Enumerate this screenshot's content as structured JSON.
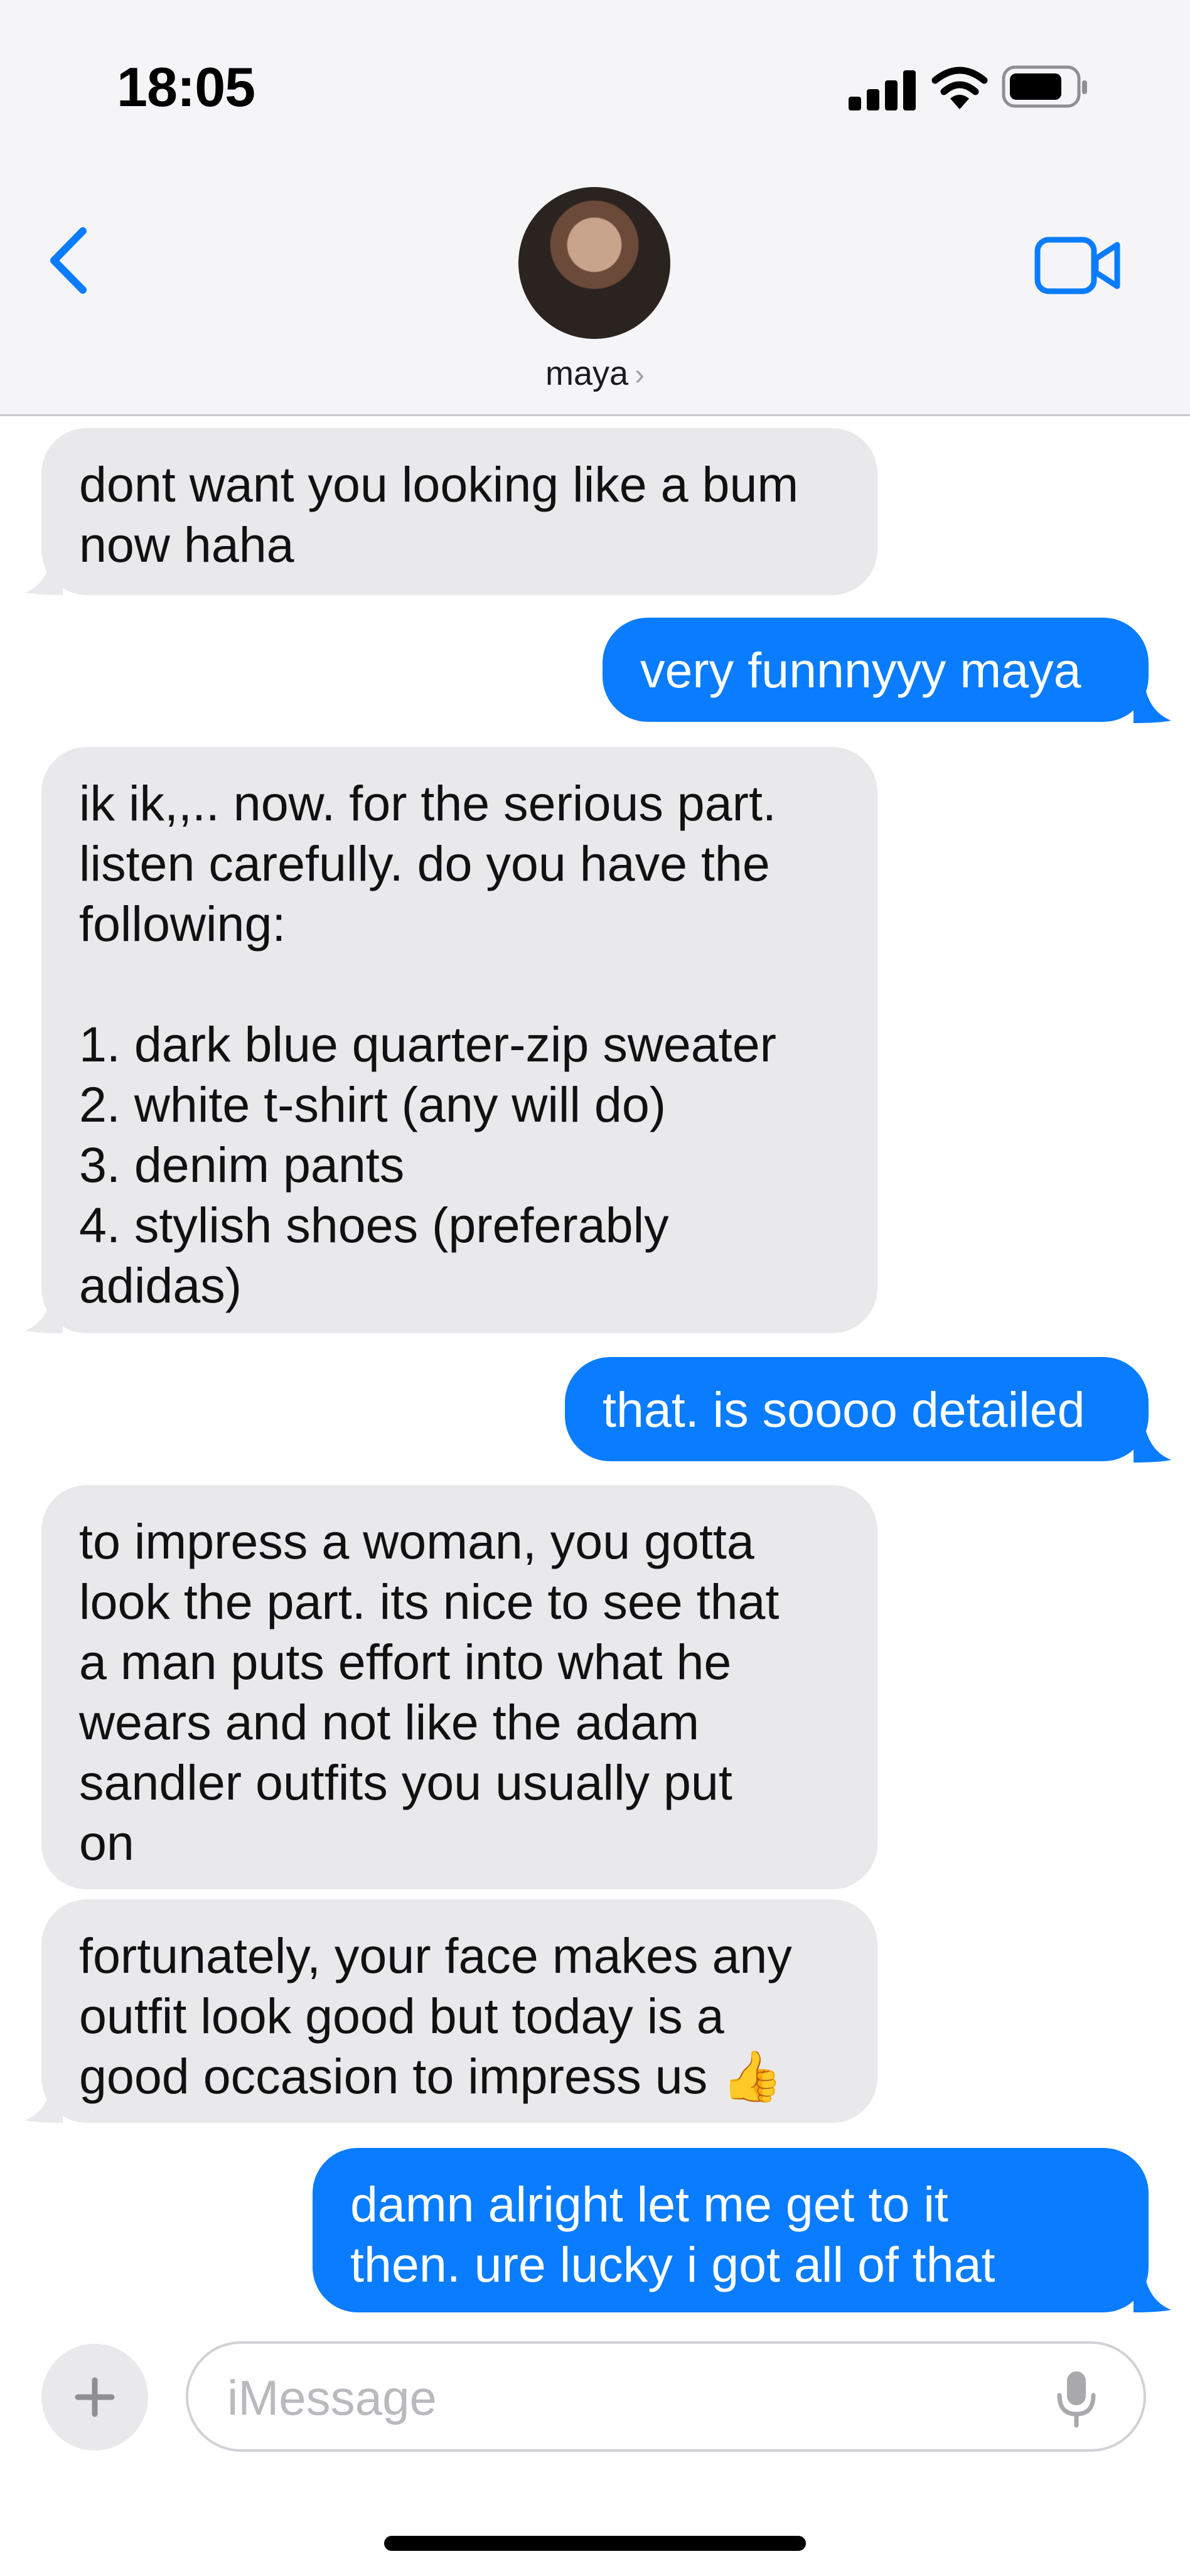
{
  "status_bar": {
    "time": "18:05",
    "icons": [
      "cellular-signal-icon",
      "wifi-icon",
      "battery-icon"
    ]
  },
  "header": {
    "back_icon": "chevron-left-icon",
    "contact_name": "maya",
    "name_chevron": "›",
    "video_icon": "video-camera-icon"
  },
  "messages": [
    {
      "from": "maya",
      "text": "dont want you looking like a bum\nnow haha"
    },
    {
      "from": "me",
      "text": "very funnnyyy maya"
    },
    {
      "from": "maya",
      "text": "ik ik,,.. now. for the serious part.\nlisten carefully. do you have the\nfollowing:\n\n1. dark blue quarter-zip sweater\n2. white t-shirt (any will do)\n3. denim pants\n4. stylish shoes (preferably\nadidas)"
    },
    {
      "from": "me",
      "text": "that. is soooo detailed"
    },
    {
      "from": "maya",
      "text": "to impress a woman, you gotta\nlook the part. its nice to see that\na man puts effort into what he\nwears and not like the adam\nsandler outfits you usually put\non"
    },
    {
      "from": "maya",
      "text": "fortunately, your face makes any\noutfit look good but today is a\ngood occasion to impress us 👍"
    },
    {
      "from": "me",
      "text": "damn alright let me get to it\nthen. ure lucky i got all of that"
    }
  ],
  "input": {
    "placeholder": "iMessage",
    "value": "",
    "plus_icon": "plus-icon",
    "mic_icon": "microphone-icon"
  },
  "colors": {
    "outgoing_bubble": "#0a7cff",
    "incoming_bubble": "#e9e9eb",
    "accent": "#0a7cff"
  }
}
